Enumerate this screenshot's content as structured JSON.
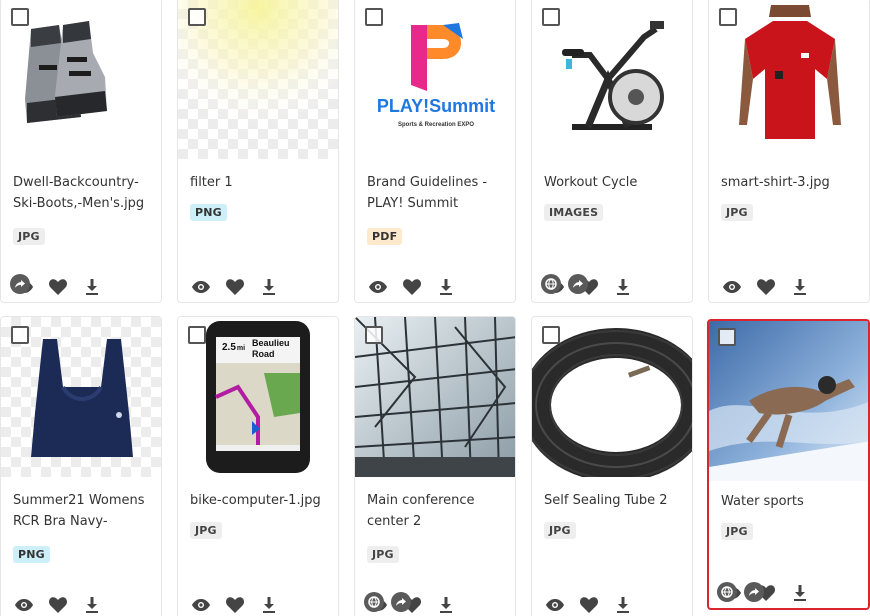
{
  "cards": [
    {
      "title": "Dwell-Backcountry-Ski-Boots,-Men's.jpg",
      "badge": "JPG",
      "thumb_icon": "ski-boots-image"
    },
    {
      "title": "filter 1",
      "badge": "PNG",
      "thumb_icon": "filter-gradient-image"
    },
    {
      "title": "Brand Guidelines - PLAY! Summit",
      "badge": "PDF",
      "thumb_icon": "play-summit-logo",
      "logo_text": "PLAY!Summit",
      "logo_sub": "Sports & Recreation EXPO"
    },
    {
      "title": "Workout Cycle",
      "badge": "IMAGES",
      "thumb_icon": "exercise-bike-image"
    },
    {
      "title": "smart-shirt-3.jpg",
      "badge": "JPG",
      "thumb_icon": "red-shirt-image"
    },
    {
      "title": "Summer21 Womens RCR Bra Navy-",
      "badge": "PNG",
      "thumb_icon": "sports-bra-image"
    },
    {
      "title": "bike-computer-1.jpg",
      "badge": "JPG",
      "thumb_icon": "bike-computer-image",
      "screen_distance": "2.5",
      "screen_unit": "mi",
      "screen_street": "Beaulieu Road"
    },
    {
      "title": "Main conference center 2",
      "badge": "JPG",
      "thumb_icon": "glass-building-image"
    },
    {
      "title": "Self Sealing Tube 2",
      "badge": "JPG",
      "thumb_icon": "bike-tube-image"
    },
    {
      "title": "Water sports",
      "badge": "JPG",
      "thumb_icon": "swimmer-image"
    }
  ],
  "colors": {
    "selected_border": "#d9262f",
    "icon": "#444444"
  }
}
